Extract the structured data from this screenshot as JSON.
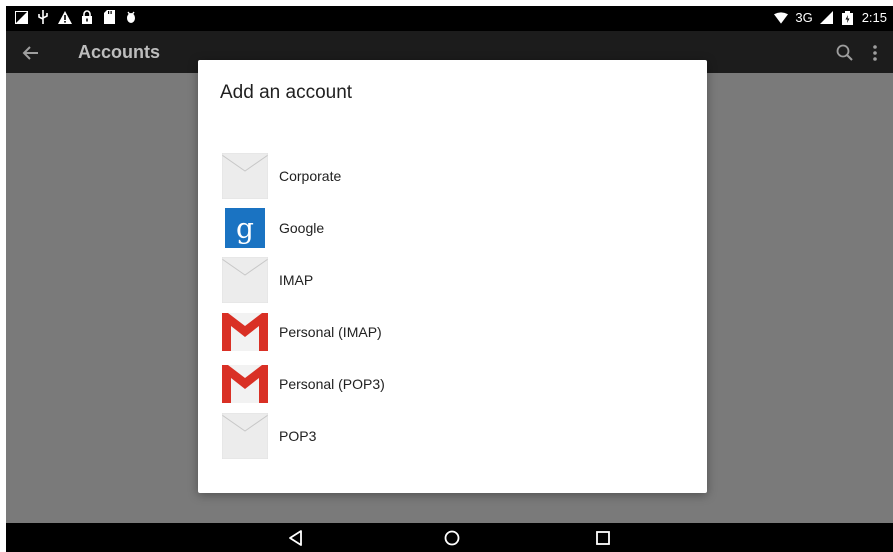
{
  "status_bar": {
    "network": "3G",
    "time": "2:15"
  },
  "app_bar": {
    "title": "Accounts"
  },
  "dialog": {
    "title": "Add an account",
    "items": [
      {
        "label": "Corporate",
        "icon": "envelope-icon"
      },
      {
        "label": "Google",
        "icon": "google-icon"
      },
      {
        "label": "IMAP",
        "icon": "envelope-icon"
      },
      {
        "label": "Personal (IMAP)",
        "icon": "gmail-icon"
      },
      {
        "label": "Personal (POP3)",
        "icon": "gmail-icon"
      },
      {
        "label": "POP3",
        "icon": "envelope-icon"
      }
    ]
  },
  "colors": {
    "scrim": "#7a7a7a",
    "app_bar": "#1c1c1c",
    "google_blue": "#1a73c2",
    "gmail_red": "#d93025"
  }
}
